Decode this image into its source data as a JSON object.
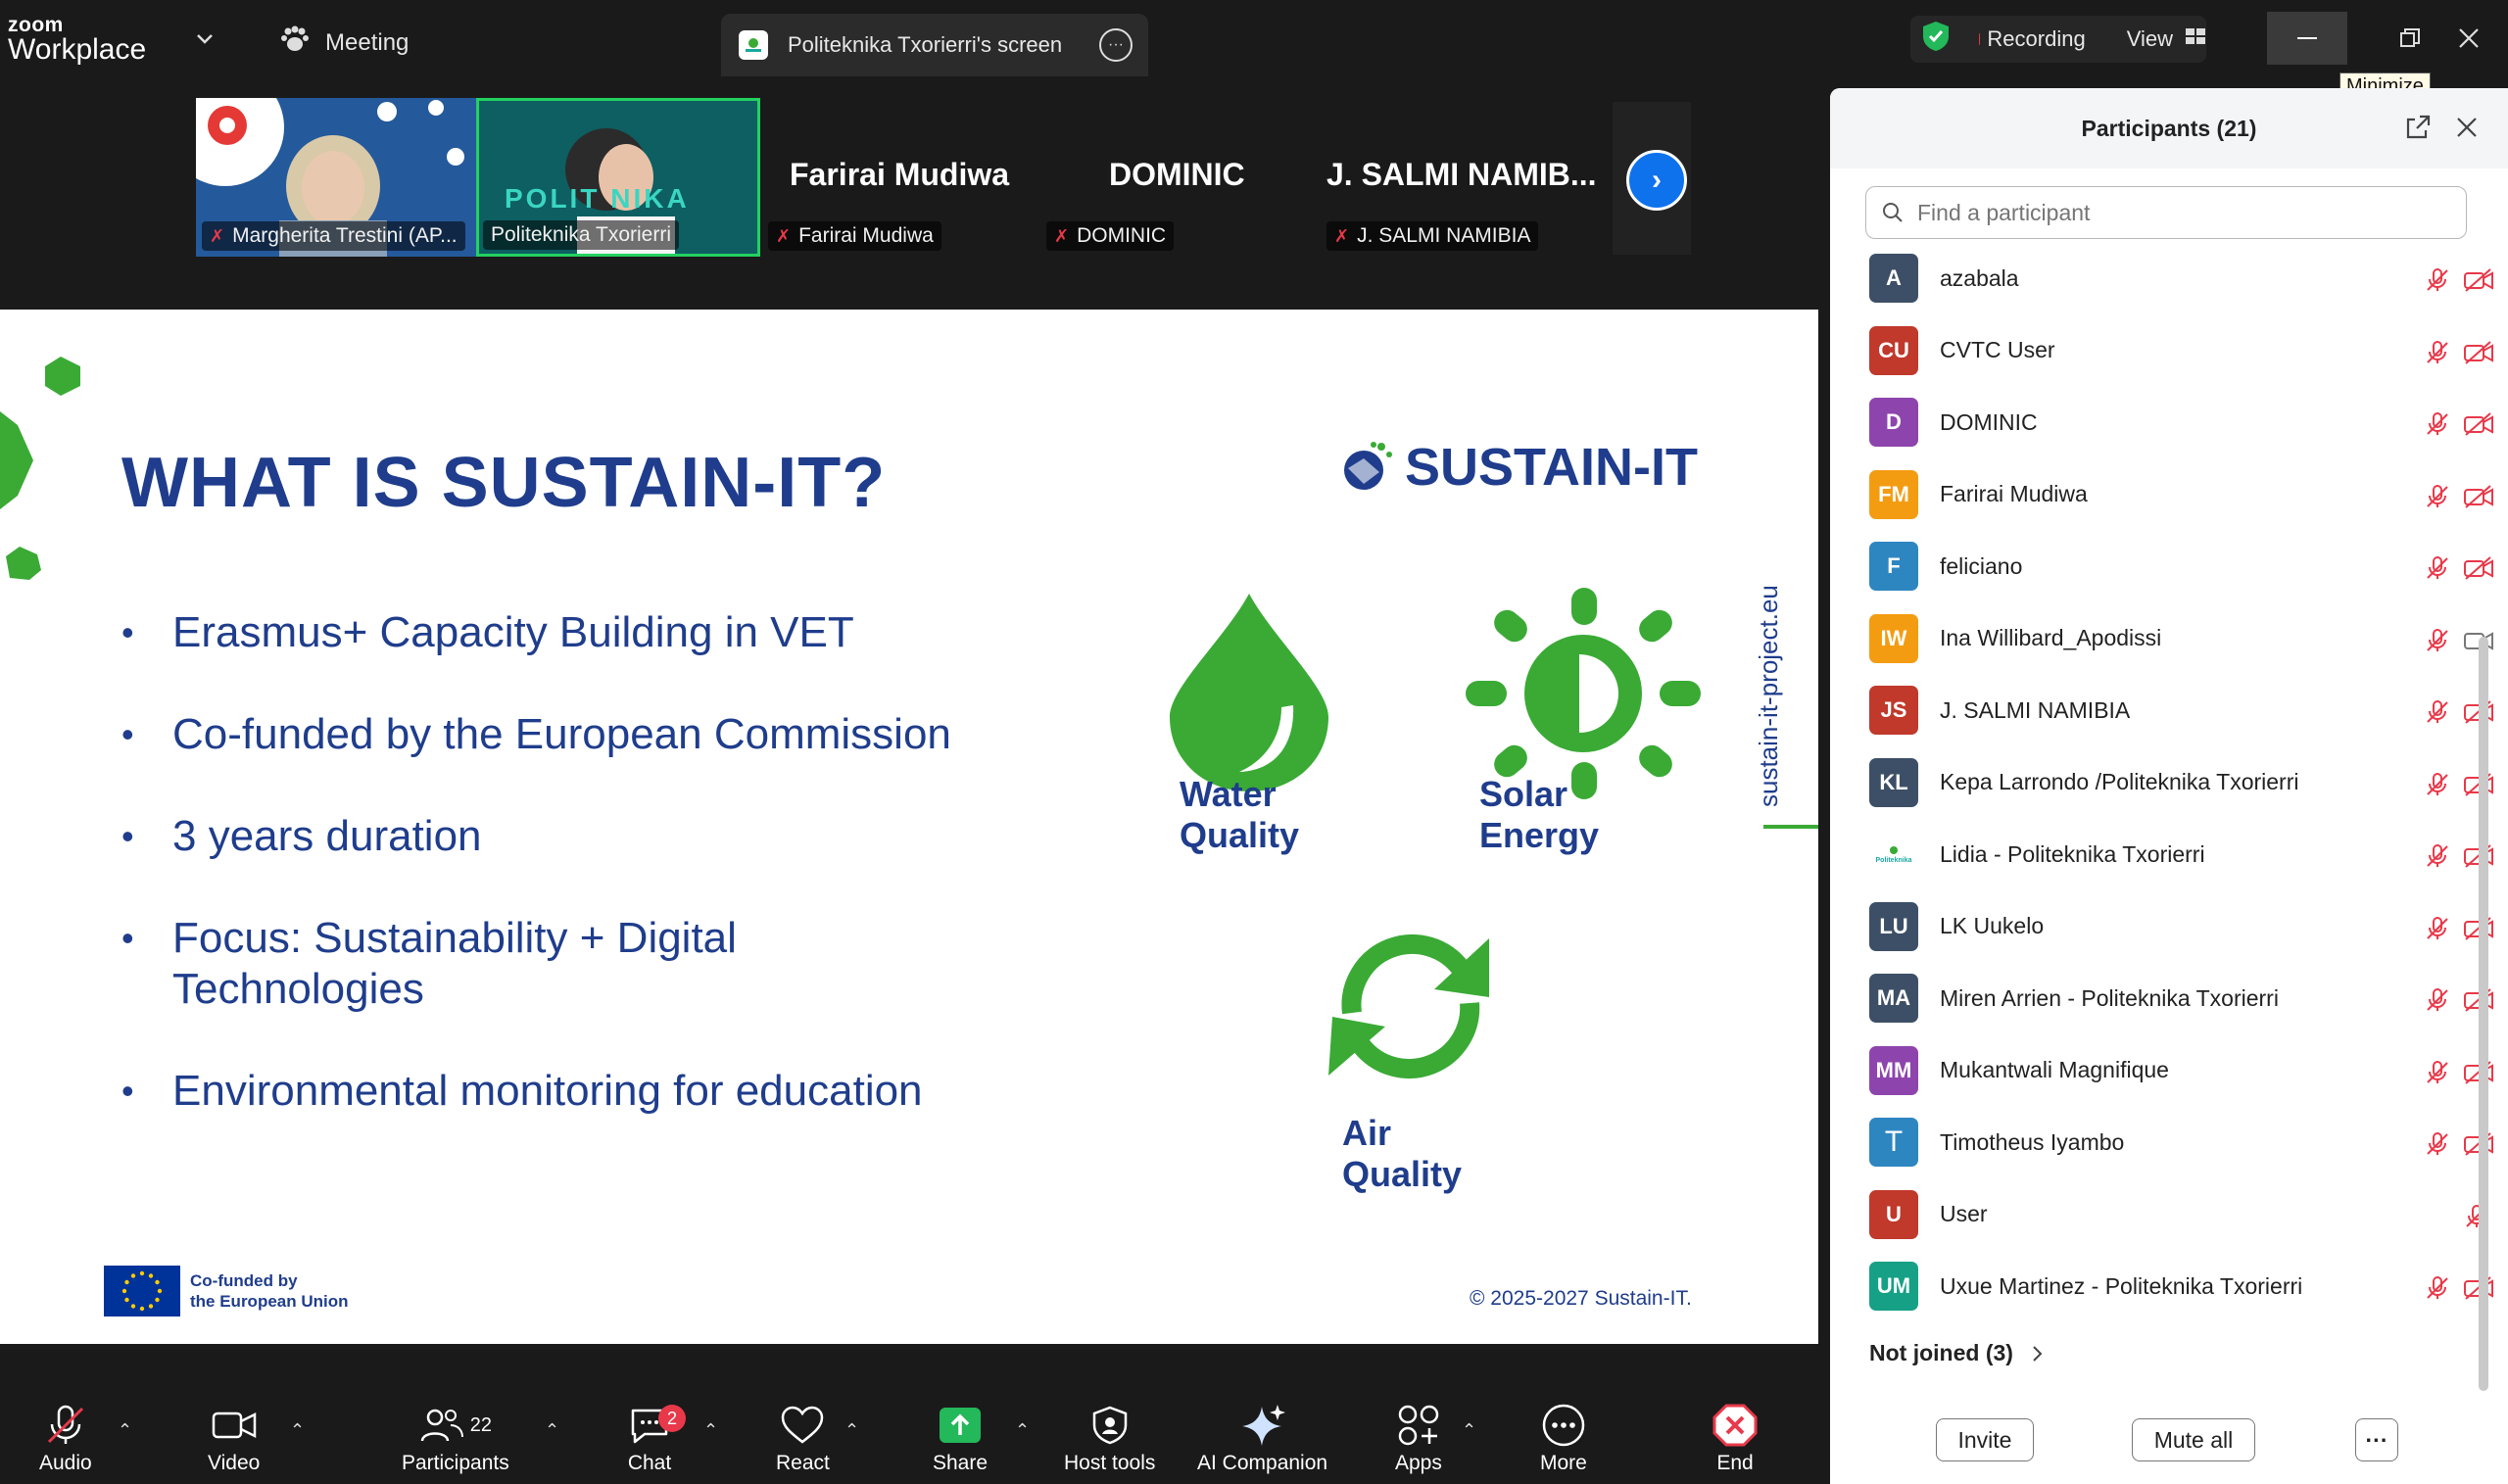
{
  "titlebar": {
    "logo_small": "zoom",
    "logo_large": "Workplace",
    "meeting_label": "Meeting",
    "share_tab_title": "Politeknika Txorierri's screen",
    "recording_label": "Recording",
    "view_label": "View",
    "tooltip": "Minimize"
  },
  "video_strip": {
    "tiles": [
      {
        "name": "Margherita Trestini (AP..."
      },
      {
        "name": "Politeknika Txorierri",
        "overlay": "POLIT  NIKA"
      },
      {
        "big_name": "Farirai Mudiwa",
        "name": "Farirai Mudiwa"
      },
      {
        "big_name": "DOMINIC",
        "name": "DOMINIC"
      },
      {
        "big_name": "J. SALMI NAMIB...",
        "name": "J. SALMI NAMIBIA"
      }
    ]
  },
  "slide": {
    "title": "WHAT IS SUSTAIN-IT?",
    "brand": "SUSTAIN-IT",
    "bullets": [
      "Erasmus+ Capacity Building in VET",
      "Co-funded by the European Commission",
      "3 years duration",
      "Focus: Sustainability + Digital Technologies",
      "Environmental monitoring for education"
    ],
    "water_label_1": "Water",
    "water_label_2": "Quality",
    "solar_label_1": "Solar",
    "solar_label_2": "Energy",
    "air_label_1": "Air",
    "air_label_2": "Quality",
    "side_url": "sustain-it-project.eu",
    "eu_line1": "Co-funded by",
    "eu_line2": "the European Union",
    "copyright": "© 2025-2027 Sustain-IT.",
    "colors": {
      "navy": "#1f3d8c",
      "green": "#3aaa35"
    }
  },
  "toolbar": {
    "audio": "Audio",
    "video": "Video",
    "participants": "Participants",
    "participants_count": "22",
    "chat": "Chat",
    "chat_badge": "2",
    "react": "React",
    "share": "Share",
    "host_tools": "Host tools",
    "ai_companion": "AI Companion",
    "apps": "Apps",
    "more": "More",
    "end": "End"
  },
  "participants_panel": {
    "title": "Participants (21)",
    "search_placeholder": "Find a participant",
    "participants": [
      {
        "initials": "A",
        "name": "azabala",
        "color": "#3d4f66",
        "mic_muted": true,
        "cam_off": true
      },
      {
        "initials": "CU",
        "name": "CVTC User",
        "color": "#c0392b",
        "mic_muted": true,
        "cam_off": true
      },
      {
        "initials": "D",
        "name": "DOMINIC",
        "color": "#8e44ad",
        "mic_muted": true,
        "cam_off": true
      },
      {
        "initials": "FM",
        "name": "Farirai Mudiwa",
        "color": "#f39c12",
        "mic_muted": true,
        "cam_off": true
      },
      {
        "initials": "F",
        "name": "feliciano",
        "color": "#2e86c1",
        "mic_muted": true,
        "cam_off": true
      },
      {
        "initials": "IW",
        "name": "Ina Willibard_Apodissi",
        "color": "#f39c12",
        "mic_muted": true,
        "cam_off": false
      },
      {
        "initials": "JS",
        "name": "J. SALMI NAMIBIA",
        "color": "#c0392b",
        "mic_muted": true,
        "cam_off": true
      },
      {
        "initials": "KL",
        "name": "Kepa Larrondo /Politeknika Txorierri",
        "color": "#3d4f66",
        "mic_muted": true,
        "cam_off": true
      },
      {
        "initials": "Politeknika",
        "name": "Lidia - Politeknika Txorierri",
        "color": "#ffffff",
        "mic_muted": true,
        "cam_off": true
      },
      {
        "initials": "LU",
        "name": "LK Uukelo",
        "color": "#3d4f66",
        "mic_muted": true,
        "cam_off": true
      },
      {
        "initials": "MA",
        "name": "Miren Arrien - Politeknika Txorierri",
        "color": "#3d4f66",
        "mic_muted": true,
        "cam_off": true
      },
      {
        "initials": "MM",
        "name": "Mukantwali Magnifique",
        "color": "#8e44ad",
        "mic_muted": true,
        "cam_off": true
      },
      {
        "initials": "T",
        "name": "Timotheus Iyambo",
        "color": "#2e86c1",
        "mic_muted": true,
        "cam_off": true
      },
      {
        "initials": "U",
        "name": "User",
        "color": "#c0392b",
        "mic_muted": true,
        "cam_off": false
      },
      {
        "initials": "UM",
        "name": "Uxue Martinez - Politeknika Txorierri",
        "color": "#16a085",
        "mic_muted": true,
        "cam_off": true
      }
    ],
    "not_joined": "Not joined (3)",
    "invite": "Invite",
    "mute_all": "Mute all",
    "more_label": "···"
  }
}
